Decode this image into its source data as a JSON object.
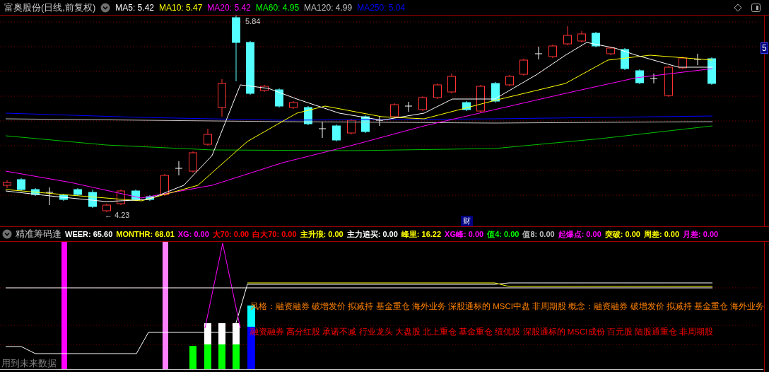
{
  "window": {
    "title": "富奥股份(日线,前复权)"
  },
  "ma_legend": [
    {
      "label": "MA5: 5.42",
      "color": "#ffffff"
    },
    {
      "label": "MA10: 5.47",
      "color": "#ffff00"
    },
    {
      "label": "MA20: 5.42",
      "color": "#ff00ff"
    },
    {
      "label": "MA60: 4.95",
      "color": "#00ff00"
    },
    {
      "label": "MA120: 4.99",
      "color": "#c0c0c0"
    },
    {
      "label": "MA250: 5.04",
      "color": "#0000ff"
    }
  ],
  "price_labels": {
    "high": "5.84",
    "low": "← 4.23",
    "event": "财",
    "price_tag": "5"
  },
  "indicator": {
    "name": "精准筹码逢",
    "values": [
      {
        "label": "WEER: 65.60",
        "color": "#ffffff"
      },
      {
        "label": "MONTHR: 68.01",
        "color": "#ffff00"
      },
      {
        "label": "XG: 0.00",
        "color": "#ff00ff"
      },
      {
        "label": "大70: 0.00",
        "color": "#ff0000"
      },
      {
        "label": "白大70: 0.00",
        "color": "#ff0000"
      },
      {
        "label": "主升浪: 0.00",
        "color": "#ffff00"
      },
      {
        "label": "主力追买: 0.00",
        "color": "#ffffff"
      },
      {
        "label": "峰里: 16.22",
        "color": "#ffff00"
      },
      {
        "label": "XG峰: 0.00",
        "color": "#ff00ff"
      },
      {
        "label": "值4: 0.00",
        "color": "#00ff00"
      },
      {
        "label": "值8: 0.00",
        "color": "#c0c0c0"
      },
      {
        "label": "起爆点: 0.00",
        "color": "#ff00ff"
      },
      {
        "label": "突破: 0.00",
        "color": "#ffff00"
      },
      {
        "label": "周差: 0.00",
        "color": "#ffff00"
      },
      {
        "label": "月差: 0.00",
        "color": "#ff00ff"
      }
    ]
  },
  "concept_lines": [
    {
      "text": "风格：融资融券 破增发价 拟减持 基金重仓 海外业务 深股通标的 MSCI中盘 非周期股 概念：融资融券 破增发价 拟减持 基金重仓 海外业务",
      "color": "#ff8000"
    },
    {
      "text": "融资融券 高分红股 承诺不减 行业龙头 大盘股 北上重仓 基金重仓 绩优股 深股通标的 MSCI成份 百元股 陆股通重仓 非周期股",
      "color": "#ff0000"
    }
  ],
  "footnote": "用到未来数据"
}
